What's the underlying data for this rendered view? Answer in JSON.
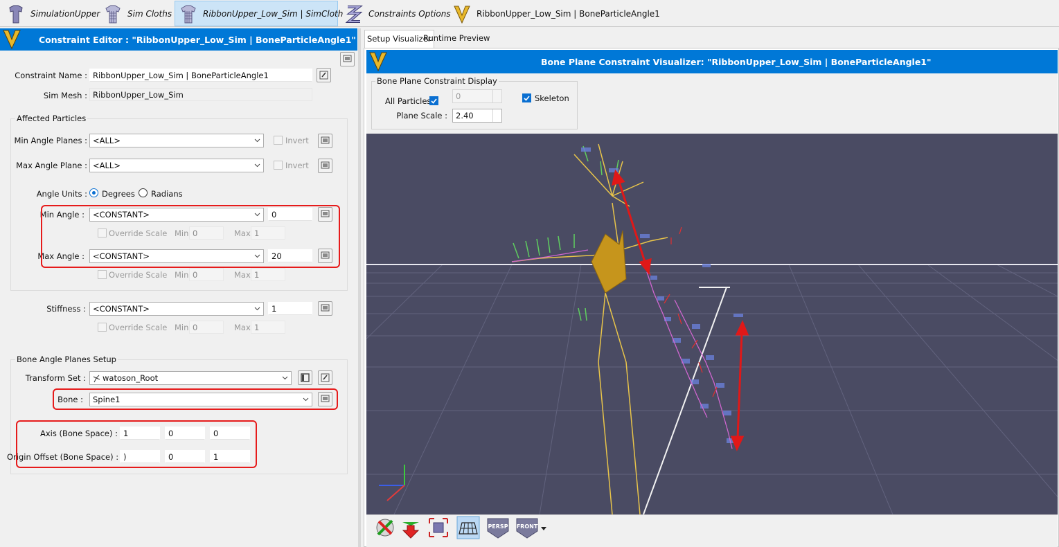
{
  "breadcrumbs": [
    {
      "label": "SimulationUpper",
      "icon": "shirt-icon"
    },
    {
      "label": "Sim Cloths",
      "icon": "cloth-mesh-icon"
    },
    {
      "label": "RibbonUpper_Low_Sim | SimCloth",
      "icon": "cloth-mesh-icon"
    },
    {
      "label": "Constraints Options",
      "icon": "constraints-icon"
    },
    {
      "label": "RibbonUpper_Low_Sim | BoneParticleAngle1",
      "icon": "v-logo-icon"
    }
  ],
  "editor": {
    "title": "Constraint Editor : \"RibbonUpper_Low_Sim | BoneParticleAngle1\"",
    "constraint_name_label": "Constraint Name :",
    "constraint_name_value": "RibbonUpper_Low_Sim | BoneParticleAngle1",
    "sim_mesh_label": "Sim Mesh :",
    "sim_mesh_value": "RibbonUpper_Low_Sim",
    "affected_particles_title": "Affected Particles",
    "min_angle_planes_label": "Min Angle Planes :",
    "min_angle_planes_value": "<ALL>",
    "max_angle_plane_label": "Max Angle Plane :",
    "max_angle_plane_value": "<ALL>",
    "invert_label": "Invert",
    "angle_units_label": "Angle Units :",
    "degrees_label": "Degrees",
    "radians_label": "Radians",
    "min_angle_label": "Min Angle :",
    "min_angle_mode": "<CONSTANT>",
    "min_angle_value": "0",
    "max_angle_label": "Max Angle :",
    "max_angle_mode": "<CONSTANT>",
    "max_angle_value": "20",
    "override_scale_label": "Override Scale",
    "min_label": "Min",
    "max_label": "Max",
    "scale_min": "0",
    "scale_max": "1",
    "stiffness_label": "Stiffness :",
    "stiffness_mode": "<CONSTANT>",
    "stiffness_value": "1",
    "bone_setup_title": "Bone Angle Planes Setup",
    "transform_set_label": "Transform Set :",
    "transform_set_value": "watoson_Root",
    "bone_label": "Bone :",
    "bone_value": "Spine1",
    "axis_label": "Axis (Bone Space) :",
    "axis_values": [
      "1",
      "0",
      "0"
    ],
    "origin_label": "Origin Offset (Bone Space) :",
    "origin_values": [
      ")",
      "0",
      "1"
    ]
  },
  "right": {
    "tabs": [
      "Setup Visualizer",
      "Runtime Preview"
    ],
    "title": "Bone Plane Constraint Visualizer: \"RibbonUpper_Low_Sim | BoneParticleAngle1\"",
    "display_group_title": "Bone Plane Constraint Display",
    "all_particles_label": "All Particles",
    "all_particles_value": "0",
    "skeleton_label": "Skeleton",
    "plane_scale_label": "Plane Scale :",
    "plane_scale_value": "2.40",
    "toolbar": [
      "snap-icon",
      "move-down-icon",
      "frame-icon",
      "grid-icon",
      "PERSP",
      "FRONT"
    ]
  },
  "colors": {
    "accent": "#0078d7",
    "highlight": "#e61b1b",
    "viewport": "#4a4b63"
  }
}
